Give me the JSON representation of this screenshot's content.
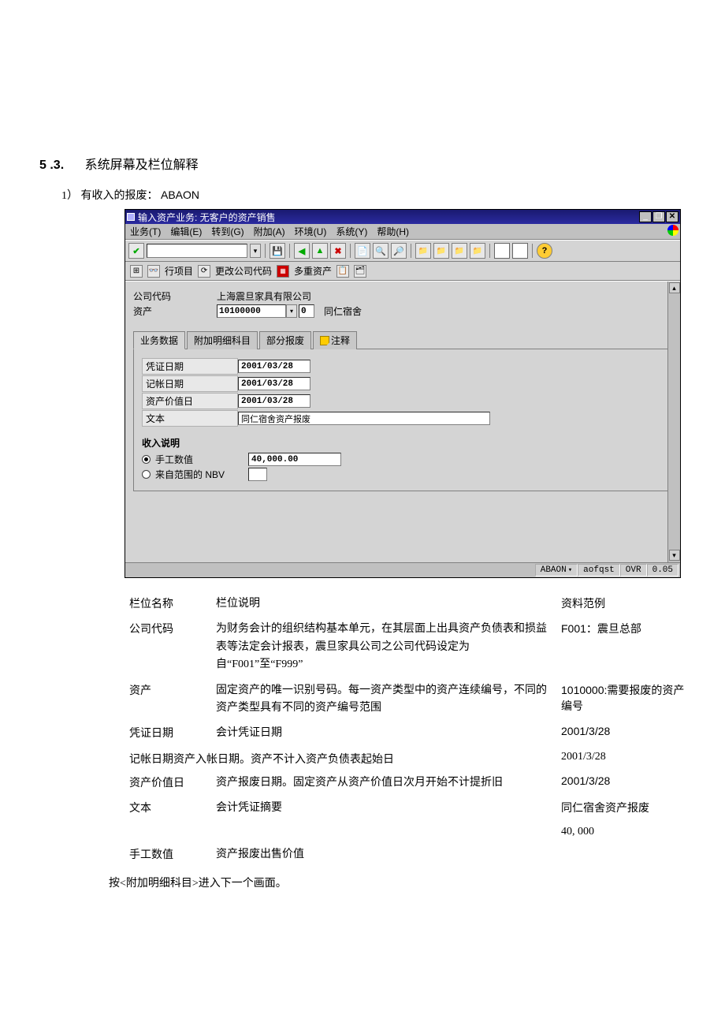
{
  "heading": {
    "num": "5 .3.",
    "title": "系统屏幕及栏位解释"
  },
  "subitem": {
    "index": "1）",
    "label": "有收入的报废：",
    "tcode": "ABAON"
  },
  "sap": {
    "title": "输入资产业务: 无客户的资产销售",
    "menu": {
      "biz": "业务(T)",
      "edit": "编辑(E)",
      "goto": "转到(G)",
      "extra": "附加(A)",
      "env": "环境(U)",
      "sys": "系统(Y)",
      "help": "帮助(H)"
    },
    "appbar": {
      "lineitem": "行项目",
      "chgcomp": "更改公司代码",
      "multi": "多重资产"
    },
    "form": {
      "company_label": "公司代码",
      "company_value": "上海震旦家具有限公司",
      "asset_label": "资产",
      "asset_value": "10100000",
      "asset_sub": "0",
      "asset_desc": "同仁宿舍"
    },
    "tabs": {
      "t1": "业务数据",
      "t2": "附加明细科目",
      "t3": "部分报废",
      "t4": "注释"
    },
    "panel": {
      "docdate_label": "凭证日期",
      "docdate": "2001/03/28",
      "postdate_label": "记帐日期",
      "postdate": "2001/03/28",
      "valdate_label": "资产价值日",
      "valdate": "2001/03/28",
      "text_label": "文本",
      "text": "同仁宿舍资产报废",
      "income_title": "收入说明",
      "radio_manual": "手工数值",
      "radio_nbv": "来自范围的 NBV",
      "amount": "40,000.00"
    },
    "status": {
      "tcode": "ABAON",
      "user": "aofqst",
      "ovr": "OVR",
      "time": "0.05"
    }
  },
  "table": {
    "hdr": {
      "c1": "栏位名称",
      "c2": "栏位说明",
      "c3": "资料范例"
    },
    "r1": {
      "c1": "公司代码",
      "c2": "为财务会计的组织结构基本单元，在其层面上出具资产负债表和损益表等法定会计报表，震旦家具公司之公司代码设定为自“F001”至“F999”",
      "c3": "F001：震旦总部"
    },
    "r2": {
      "c1": "资产",
      "c2": "固定资产的唯一识别号码。每一资产类型中的资产连续编号，不同的资产类型具有不同的资产编号范围",
      "c3": "1010000:需要报废的资产编号"
    },
    "r3": {
      "c1": "凭证日期",
      "c2": "会计凭证日期",
      "c3": "2001/3/28"
    },
    "r4": {
      "merged": "记帐日期资产入帐日期。资产不计入资产负债表起始日",
      "c3": "2001/3/28"
    },
    "r5": {
      "c1": "资产价值日",
      "c2": "资产报废日期。固定资产从资产价值日次月开始不计提折旧",
      "c3": "2001/3/28"
    },
    "r6": {
      "c1": "文本",
      "c2": "会计凭证摘要",
      "c3": "同仁宿舍资产报废"
    },
    "r7": {
      "c3": "40, 000"
    },
    "r8": {
      "c1": "手工数值",
      "c2": "资产报废出售价值"
    }
  },
  "footnote": "按<附加明细科目>进入下一个画面。"
}
